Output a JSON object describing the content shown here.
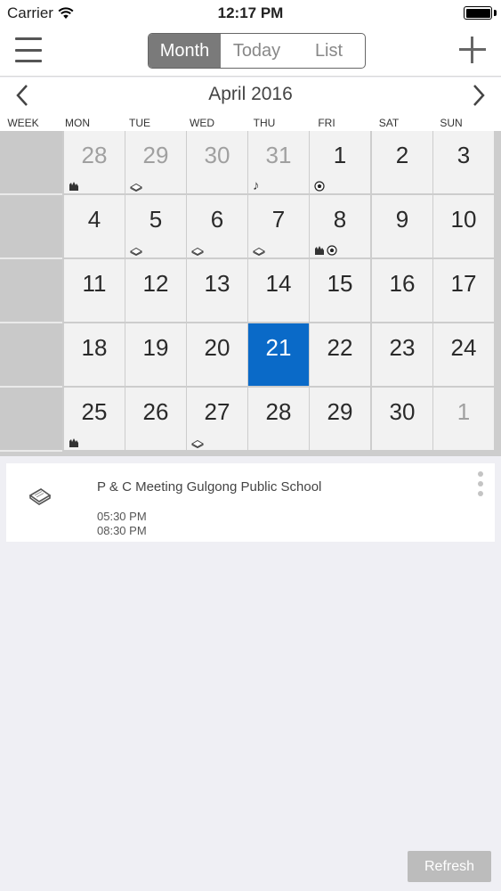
{
  "status_bar": {
    "carrier": "Carrier",
    "time": "12:17 PM",
    "wifi_icon": "wifi-icon",
    "battery_icon": "battery-icon"
  },
  "nav": {
    "menu_icon": "hamburger-icon",
    "segments": [
      {
        "label": "Month",
        "active": true
      },
      {
        "label": "Today",
        "active": false
      },
      {
        "label": "List",
        "active": false
      }
    ],
    "add_icon": "plus-icon"
  },
  "calendar": {
    "month_title": "April 2016",
    "prev_icon": "chevron-left-icon",
    "next_icon": "chevron-right-icon",
    "headers": [
      "WEEK",
      "MON",
      "TUE",
      "WED",
      "THU",
      "FRI",
      "SAT",
      "SUN"
    ],
    "weeks": [
      [
        {
          "num": "28",
          "muted": true,
          "icons": [
            "badge"
          ]
        },
        {
          "num": "29",
          "muted": true,
          "icons": [
            "book"
          ]
        },
        {
          "num": "30",
          "muted": true,
          "icons": []
        },
        {
          "num": "31",
          "muted": true,
          "icons": [
            "music"
          ]
        },
        {
          "num": "1",
          "muted": false,
          "icons": [
            "soccer"
          ]
        },
        {
          "num": "2",
          "muted": false,
          "icons": []
        },
        {
          "num": "3",
          "muted": false,
          "icons": []
        }
      ],
      [
        {
          "num": "4",
          "muted": false,
          "icons": []
        },
        {
          "num": "5",
          "muted": false,
          "icons": [
            "book"
          ]
        },
        {
          "num": "6",
          "muted": false,
          "icons": [
            "book"
          ]
        },
        {
          "num": "7",
          "muted": false,
          "icons": [
            "book"
          ]
        },
        {
          "num": "8",
          "muted": false,
          "icons": [
            "badge",
            "soccer"
          ]
        },
        {
          "num": "9",
          "muted": false,
          "icons": []
        },
        {
          "num": "10",
          "muted": false,
          "icons": []
        }
      ],
      [
        {
          "num": "11",
          "muted": false,
          "icons": []
        },
        {
          "num": "12",
          "muted": false,
          "icons": []
        },
        {
          "num": "13",
          "muted": false,
          "icons": []
        },
        {
          "num": "14",
          "muted": false,
          "icons": []
        },
        {
          "num": "15",
          "muted": false,
          "icons": []
        },
        {
          "num": "16",
          "muted": false,
          "icons": []
        },
        {
          "num": "17",
          "muted": false,
          "icons": []
        }
      ],
      [
        {
          "num": "18",
          "muted": false,
          "icons": []
        },
        {
          "num": "19",
          "muted": false,
          "icons": []
        },
        {
          "num": "20",
          "muted": false,
          "icons": []
        },
        {
          "num": "21",
          "muted": false,
          "selected": true,
          "icons": []
        },
        {
          "num": "22",
          "muted": false,
          "icons": []
        },
        {
          "num": "23",
          "muted": false,
          "icons": []
        },
        {
          "num": "24",
          "muted": false,
          "icons": []
        }
      ],
      [
        {
          "num": "25",
          "muted": false,
          "icons": [
            "badge"
          ]
        },
        {
          "num": "26",
          "muted": false,
          "icons": []
        },
        {
          "num": "27",
          "muted": false,
          "icons": [
            "book"
          ]
        },
        {
          "num": "28",
          "muted": false,
          "icons": []
        },
        {
          "num": "29",
          "muted": false,
          "icons": []
        },
        {
          "num": "30",
          "muted": false,
          "icons": []
        },
        {
          "num": "1",
          "muted": true,
          "icons": []
        }
      ]
    ]
  },
  "event": {
    "icon": "book-icon",
    "title": "P & C Meeting Gulgong Public School",
    "start": "05:30 PM",
    "end": "08:30 PM",
    "more_icon": "more-vertical-icon"
  },
  "footer": {
    "refresh_label": "Refresh"
  },
  "colors": {
    "selected": "#0a6ac8",
    "segment_active": "#7a7a7a",
    "refresh": "#bcbcbc"
  }
}
